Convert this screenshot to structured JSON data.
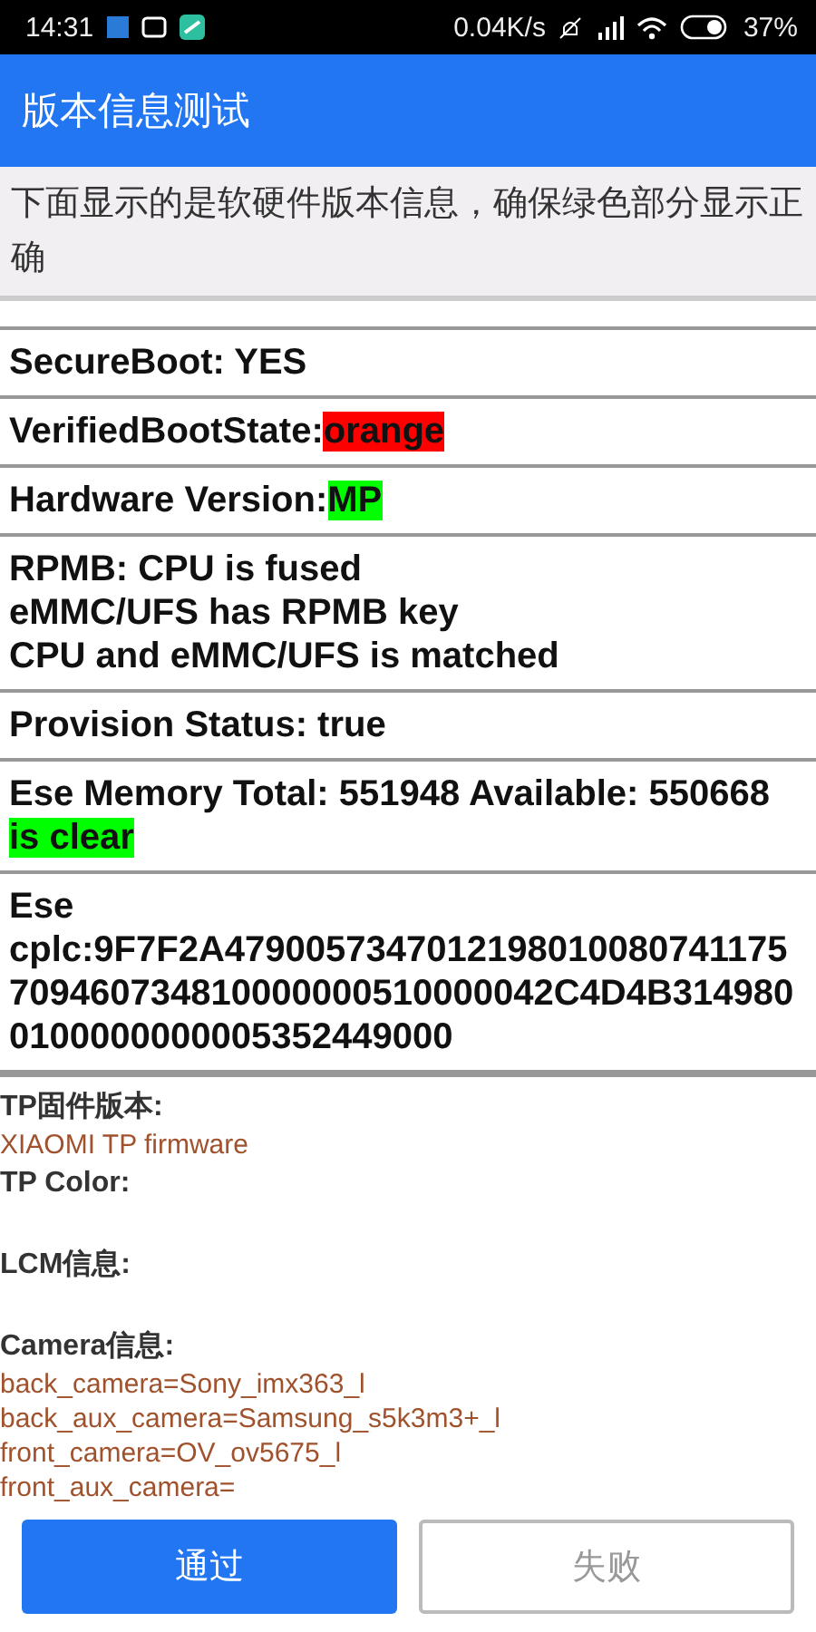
{
  "status_bar": {
    "time": "14:31",
    "speed": "0.04K/s",
    "battery": "37%"
  },
  "app_bar": {
    "title": "版本信息测试"
  },
  "notice": "下面显示的是软硬件版本信息，确保绿色部分显示正确",
  "rows": [
    {
      "text": "SecureBoot: YES"
    },
    {
      "text": "VerifiedBootState:",
      "highlight": {
        "text": "orange",
        "color": "#ff0000"
      }
    },
    {
      "text": "Hardware Version:",
      "highlight": {
        "text": "MP",
        "color": "#00ff00"
      }
    },
    {
      "text": "RPMB: CPU is fused\neMMC/UFS has RPMB key\nCPU and eMMC/UFS is matched\n"
    },
    {
      "text": "Provision Status: true"
    },
    {
      "text": "Ese Memory Total: 551948 Available: 550668 ",
      "highlight": {
        "text": "is clear",
        "color": "#00ff00"
      }
    },
    {
      "text": "Ese cplc:9F7F2A4790057347012198010080741175709460734810000000510000042C4D4B3149800100000000005352449000"
    }
  ],
  "details": [
    {
      "label": "TP固件版本:",
      "values": [
        "XIAOMI TP firmware"
      ]
    },
    {
      "label": "TP Color:"
    },
    {
      "label": "LCM信息:"
    },
    {
      "label": "Camera信息:",
      "values": [
        "back_camera=Sony_imx363_l",
        "back_aux_camera=Samsung_s5k3m3+_l",
        "front_camera=OV_ov5675_l",
        "front_aux_camera="
      ]
    }
  ],
  "buttons": [
    {
      "label": "通过",
      "kind": "primary"
    },
    {
      "label": "失败",
      "kind": "secondary"
    }
  ]
}
